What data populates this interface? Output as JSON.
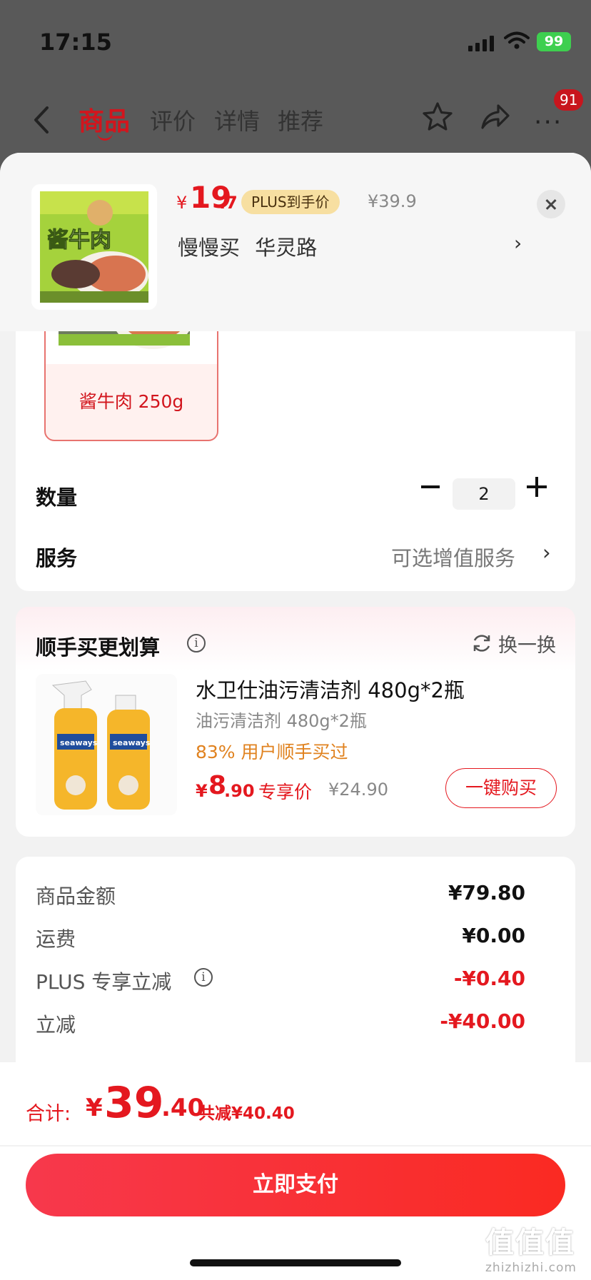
{
  "status": {
    "time": "17:15",
    "battery": "99"
  },
  "nav": {
    "tabs": [
      "商品",
      "评价",
      "详情",
      "推荐"
    ],
    "badge": "91"
  },
  "header": {
    "price_symbol": "¥",
    "price_int": "19",
    "price_dec": ".7",
    "plus_tag": "PLUS到手价",
    "original_price": "¥39.9",
    "address": "慢慢买 华灵路",
    "thumb_text": "酱牛肉"
  },
  "options": {
    "sku_label": "酱牛肉 250g",
    "quantity_label": "数量",
    "quantity": "2",
    "service_label": "服务",
    "service_value": "可选增值服务"
  },
  "bundle": {
    "title": "顺手买更划算",
    "swap_label": "换一换",
    "name": "水卫仕油污清洁剂 480g*2瓶",
    "spec": "油污清洁剂 480g*2瓶",
    "bought": "83% 用户顺手买过",
    "price_symbol": "¥",
    "price_int": "8",
    "price_dec": ".90",
    "exclusive_label": "专享价",
    "original_price": "¥24.90",
    "buy_button": "一键购买",
    "brand": "seaways"
  },
  "summary": {
    "rows": [
      {
        "label": "商品金额",
        "value": "¥79.80"
      },
      {
        "label": "运费",
        "value": "¥0.00"
      },
      {
        "label": "PLUS 专享立减",
        "value": "-¥0.40"
      },
      {
        "label": "立减",
        "value": "-¥40.00"
      }
    ]
  },
  "footer": {
    "total_label": "合计:",
    "total_symbol": "¥",
    "total_int": "39",
    "total_dec": ".40",
    "total_saving": "共减¥40.40",
    "pay_button": "立即支付",
    "watermark": "值值值",
    "watermark_site": "zhizhizhi.com"
  },
  "colors": {
    "accent": "#e4181f",
    "plus_gold": "#f7dfa1",
    "orange": "#e0821f"
  }
}
